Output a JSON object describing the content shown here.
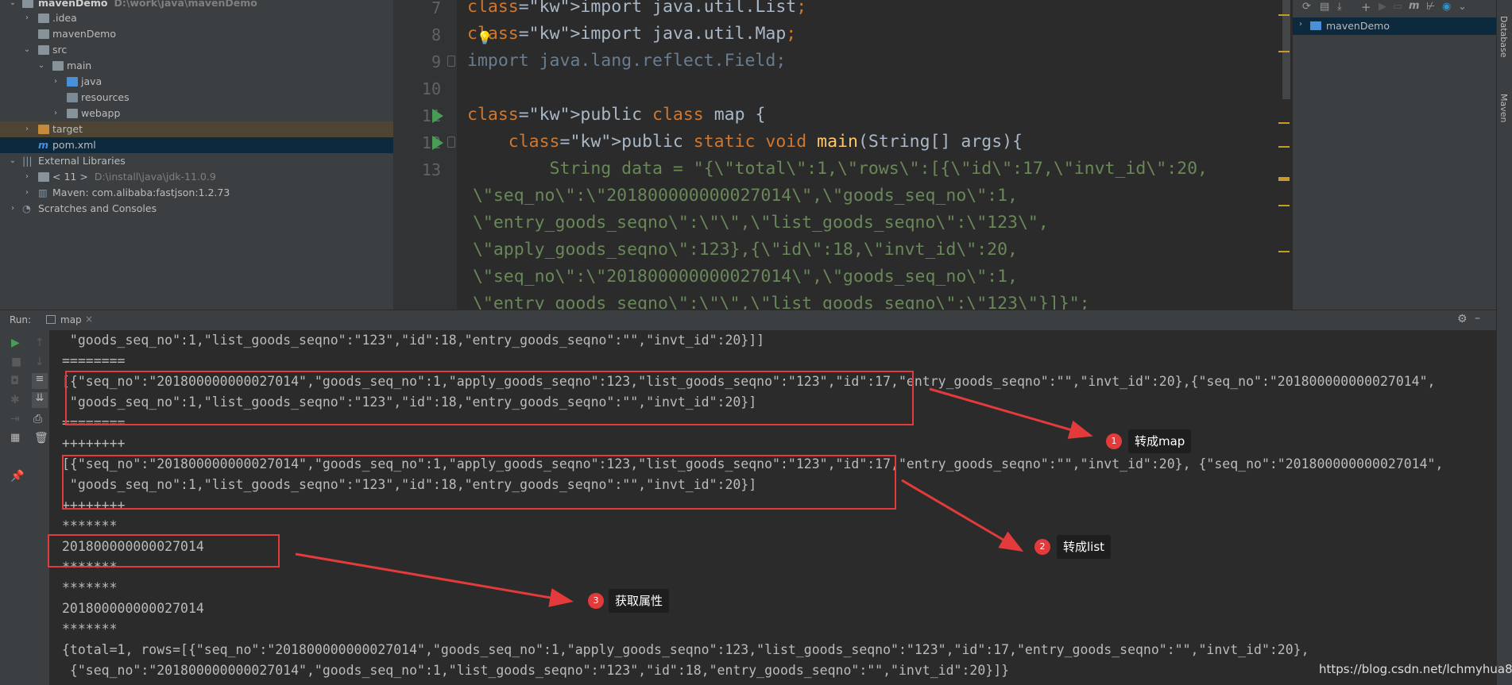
{
  "project": {
    "rows": [
      {
        "label": "mavenDemo",
        "dim": "D:\\work\\java\\mavenDemo",
        "bold": true
      },
      {
        "label": ".idea"
      },
      {
        "label": "mavenDemo"
      },
      {
        "label": "src"
      },
      {
        "label": "main"
      },
      {
        "label": "java"
      },
      {
        "label": "resources"
      },
      {
        "label": "webapp"
      },
      {
        "label": "target"
      },
      {
        "label": "pom.xml"
      },
      {
        "label": "External Libraries"
      },
      {
        "label": "< 11 >",
        "dim": "D:\\install\\java\\jdk-11.0.9"
      },
      {
        "label": "Maven: com.alibaba:fastjson:1.2.73"
      },
      {
        "label": "Scratches and Consoles"
      }
    ]
  },
  "editor": {
    "line_numbers": [
      "7",
      "8",
      "9",
      "10",
      "11",
      "12",
      "13"
    ],
    "inspection": {
      "warnings": "9",
      "weak_warnings": "7"
    },
    "code_lines": [
      "import java.util.List;",
      "import java.util.Map;",
      "import java.lang.reflect.Field;",
      "",
      "public class map {",
      "    public static void main(String[] args){",
      "        String data = \"{\\\"total\\\":1,\\\"rows\\\":[{\\\"id\\\":17,\\\"invt_id\\\":20,",
      " \\\"seq_no\\\":\\\"201800000000027014\\\",\\\"goods_seq_no\\\":1,",
      " \\\"entry_goods_seqno\\\":\\\"\\\",\\\"list_goods_seqno\\\":\\\"123\\\",",
      " \\\"apply_goods_seqno\\\":123},{\\\"id\\\":18,\\\"invt_id\\\":20,",
      " \\\"seq_no\\\":\\\"201800000000027014\\\",\\\"goods_seq_no\\\":1,",
      " \\\"entry_goods_seqno\\\":\\\"\\\",\\\"list_goods_seqno\\\":\\\"123\\\"}]}\";"
    ]
  },
  "maven": {
    "project": "mavenDemo",
    "side_labels": [
      "Database",
      "Maven"
    ]
  },
  "run": {
    "label": "Run:",
    "tab": "map"
  },
  "console": {
    "lines": [
      " \"goods_seq_no\":1,\"list_goods_seqno\":\"123\",\"id\":18,\"entry_goods_seqno\":\"\",\"invt_id\":20}]]",
      "========",
      "[{\"seq_no\":\"201800000000027014\",\"goods_seq_no\":1,\"apply_goods_seqno\":123,\"list_goods_seqno\":\"123\",\"id\":17,\"entry_goods_seqno\":\"\",\"invt_id\":20},{\"seq_no\":\"201800000000027014\",",
      " \"goods_seq_no\":1,\"list_goods_seqno\":\"123\",\"id\":18,\"entry_goods_seqno\":\"\",\"invt_id\":20}]",
      "========",
      "++++++++",
      "[{\"seq_no\":\"201800000000027014\",\"goods_seq_no\":1,\"apply_goods_seqno\":123,\"list_goods_seqno\":\"123\",\"id\":17,\"entry_goods_seqno\":\"\",\"invt_id\":20}, {\"seq_no\":\"201800000000027014\",",
      " \"goods_seq_no\":1,\"list_goods_seqno\":\"123\",\"id\":18,\"entry_goods_seqno\":\"\",\"invt_id\":20}]",
      "++++++++",
      "*******",
      "201800000000027014",
      "*******",
      "*******",
      "201800000000027014",
      "*******",
      "{total=1, rows=[{\"seq_no\":\"201800000000027014\",\"goods_seq_no\":1,\"apply_goods_seqno\":123,\"list_goods_seqno\":\"123\",\"id\":17,\"entry_goods_seqno\":\"\",\"invt_id\":20},",
      " {\"seq_no\":\"201800000000027014\",\"goods_seq_no\":1,\"list_goods_seqno\":\"123\",\"id\":18,\"entry_goods_seqno\":\"\",\"invt_id\":20}]}"
    ]
  },
  "annotations": [
    {
      "num": "1",
      "label": "转成map"
    },
    {
      "num": "2",
      "label": "转成list"
    },
    {
      "num": "3",
      "label": "获取属性"
    }
  ],
  "watermark": "https://blog.csdn.net/lchmyhua88",
  "colors": {
    "keyword": "#cc7832",
    "string": "#6a8759",
    "method": "#ffc66d",
    "highlight": "#214283",
    "annotation": "#e33b3b"
  }
}
